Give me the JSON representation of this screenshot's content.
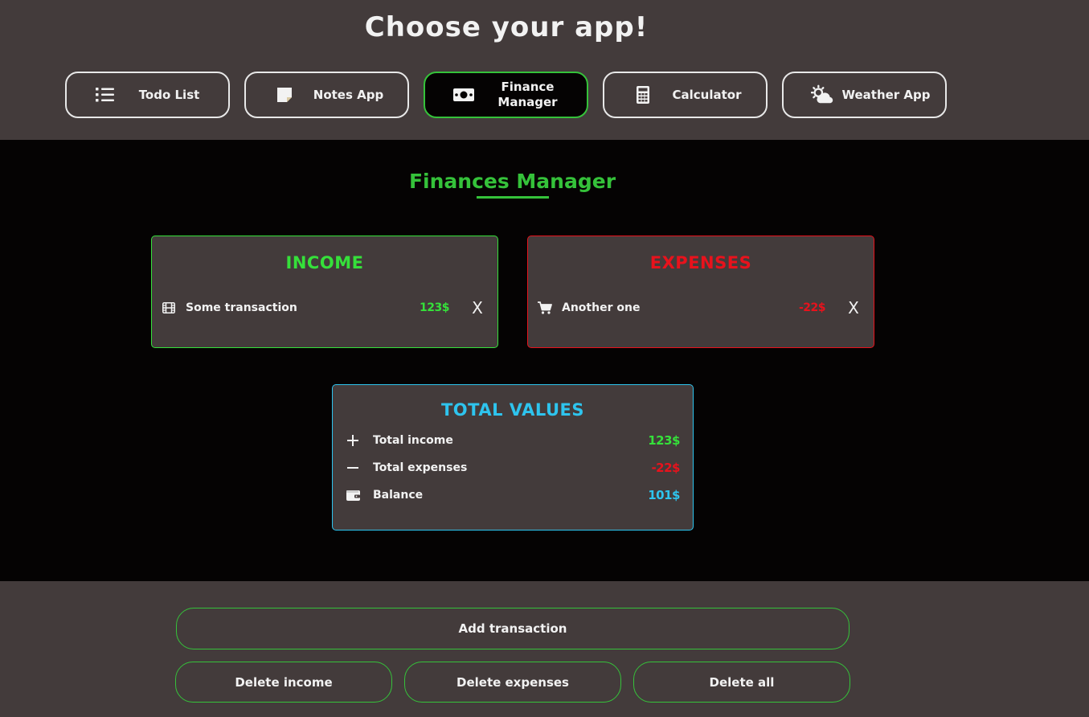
{
  "header": {
    "title": "Choose your app!",
    "apps": [
      {
        "label": "Todo List",
        "icon": "list-icon"
      },
      {
        "label": "Notes App",
        "icon": "sticky-note-icon"
      },
      {
        "label": "Finance Manager",
        "icon": "money-bill-icon",
        "active": true
      },
      {
        "label": "Calculator",
        "icon": "calculator-icon"
      },
      {
        "label": "Weather App",
        "icon": "sun-cloud-icon"
      }
    ]
  },
  "finance": {
    "title": "Finances Manager",
    "income": {
      "title": "INCOME",
      "color": "#35e03a",
      "transactions": [
        {
          "name": "Some transaction",
          "amount": "123$",
          "icon": "film-icon",
          "delete": "X"
        }
      ]
    },
    "expenses": {
      "title": "EXPENSES",
      "color": "#e8121c",
      "transactions": [
        {
          "name": "Another one",
          "amount": "-22$",
          "icon": "cart-icon",
          "delete": "X"
        }
      ]
    },
    "totals": {
      "title": "TOTAL VALUES",
      "color": "#2ec4ee",
      "rows": [
        {
          "label": "Total income",
          "value": "123$",
          "icon": "plus-icon"
        },
        {
          "label": "Total expenses",
          "value": "-22$",
          "icon": "minus-icon"
        },
        {
          "label": "Balance",
          "value": "101$",
          "icon": "wallet-icon"
        }
      ]
    }
  },
  "actions": {
    "add": "Add transaction",
    "delete_income": "Delete income",
    "delete_expenses": "Delete expenses",
    "delete_all": "Delete all"
  },
  "colors": {
    "header_bg": "#433b3b",
    "main_bg": "#050303",
    "accent_green": "#35c23a",
    "income_green": "#35e03a",
    "expense_red": "#e8121c",
    "total_blue": "#2ec4ee"
  }
}
